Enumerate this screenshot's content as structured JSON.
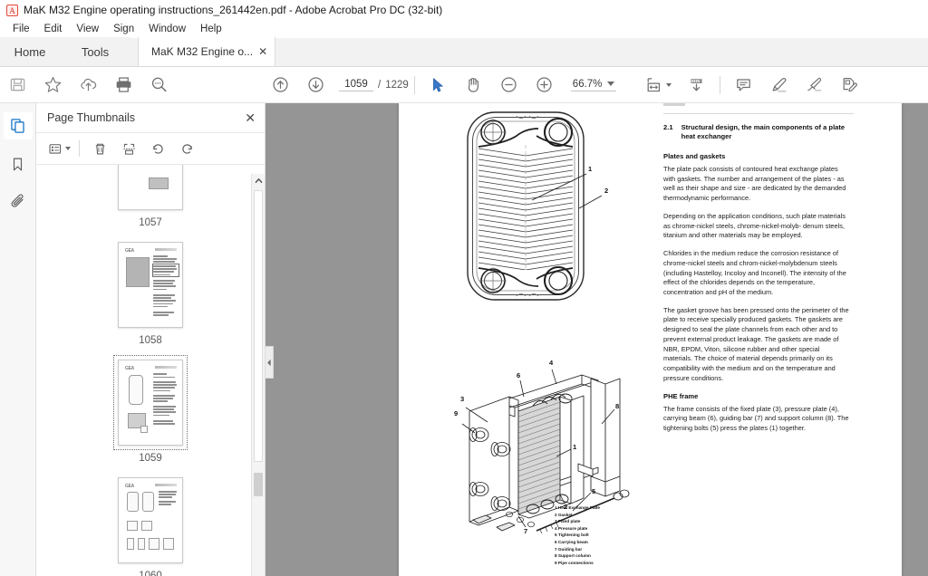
{
  "window": {
    "title": "MaK M32 Engine operating instructions_261442en.pdf - Adobe Acrobat Pro DC (32-bit)",
    "app_icon": "acrobat-logo"
  },
  "menubar": {
    "items": [
      "File",
      "Edit",
      "View",
      "Sign",
      "Window",
      "Help"
    ]
  },
  "tabs": {
    "home": "Home",
    "tools": "Tools",
    "document": "MaK M32 Engine o...",
    "close_glyph": "✕"
  },
  "toolbar": {
    "left_icons": [
      {
        "name": "save-icon",
        "label": "Save"
      },
      {
        "name": "star-icon",
        "label": "Add to favorites"
      },
      {
        "name": "cloud-upload-icon",
        "label": "Upload"
      },
      {
        "name": "print-icon",
        "label": "Print"
      },
      {
        "name": "search-icon",
        "label": "Find"
      }
    ],
    "nav_icons": [
      {
        "name": "previous-page-icon",
        "label": "Previous page"
      },
      {
        "name": "next-page-icon",
        "label": "Next page"
      }
    ],
    "page_current": "1059",
    "page_separator": "/",
    "page_total": "1229",
    "cursor_tools": [
      {
        "name": "select-tool-icon",
        "label": "Select"
      },
      {
        "name": "hand-tool-icon",
        "label": "Hand tool"
      }
    ],
    "zoom_out_icon": "zoom-out-icon",
    "zoom_in_icon": "zoom-in-icon",
    "zoom_level": "66.7%",
    "right_icons": [
      {
        "name": "fit-page-icon",
        "label": "Fit page"
      },
      {
        "name": "scroll-mode-icon",
        "label": "Scroll mode"
      },
      {
        "name": "comment-icon",
        "label": "Add comment"
      },
      {
        "name": "highlight-icon",
        "label": "Highlight text"
      },
      {
        "name": "signature-icon",
        "label": "Sign"
      },
      {
        "name": "edit-pdf-icon",
        "label": "Edit PDF"
      }
    ]
  },
  "rail": {
    "items": [
      {
        "name": "page-thumbnails-icon",
        "label": "Page Thumbnails",
        "active": true
      },
      {
        "name": "bookmarks-icon",
        "label": "Bookmarks",
        "active": false
      },
      {
        "name": "attachments-icon",
        "label": "Attachments",
        "active": false
      }
    ]
  },
  "thumbnail_panel": {
    "title": "Page Thumbnails",
    "close_glyph": "✕",
    "tools": [
      {
        "name": "thumbnail-options-icon",
        "label": "Options"
      },
      {
        "name": "delete-pages-icon",
        "label": "Delete Pages"
      },
      {
        "name": "extract-pages-icon",
        "label": "Extract Pages"
      },
      {
        "name": "rotate-counterclockwise-icon",
        "label": "Rotate Counterclockwise"
      },
      {
        "name": "rotate-clockwise-icon",
        "label": "Rotate Clockwise"
      }
    ],
    "thumbnails": [
      {
        "page": "1057",
        "selected": false,
        "kind": "figure-top"
      },
      {
        "page": "1058",
        "selected": false,
        "kind": "photo-text"
      },
      {
        "page": "1059",
        "selected": true,
        "kind": "diagram-text"
      },
      {
        "page": "1060",
        "selected": false,
        "kind": "multi-figure"
      }
    ]
  },
  "document": {
    "section_number": "2.1",
    "section_title": "Structural design, the main components of a plate heat exchanger",
    "subhead_1": "Plates and gaskets",
    "paragraphs": [
      "The plate pack consists of contoured heat exchange plates with gaskets. The number and arrangement of the plates -  as well as their shape and size - are dedicated by the demanded thermodynamic performance.",
      "Depending on the application conditions, such plate materials as chrome-nickel steels, chrome-nickel-molyb- denum steels, titanium and other materials may be employed.",
      "Chlorides in the medium reduce the corrosion resistance of chrome-nickel steels and chrom-nickel-molybdenum steels (including Hastelloy, Incoloy and Inconell). The intensity of the effect of the chlorides depends on the temperature, concentration and pH of the medium.",
      "The gasket groove has been pressed onto the perimeter of the plate to receive specially produced gaskets. The gaskets are designed to seal the plate channels from each other and to prevent external product leakage. The gaskets are made of NBR, EPDM, Viton, silicone rubber and other special materials. The choice of material depends primarily on its compatibility with the medium and on the temperature and pressure conditions."
    ],
    "subhead_2": "PHE frame",
    "paragraph_frame": "The frame consists of the fixed plate (3), pressure plate (4), carrying beam (6), guiding bar (7) and support column (8). The tightening bolts (5) press the plates (1) together.",
    "figure_plate": {
      "name": "plate-heat-exchanger-plate-diagram",
      "callouts": [
        "1",
        "2"
      ]
    },
    "figure_assembly": {
      "name": "plate-heat-exchanger-frame-assembly-diagram",
      "callouts": [
        "1",
        "2",
        "3",
        "4",
        "5",
        "6",
        "7",
        "8",
        "9"
      ]
    },
    "legend": [
      "1 Heat Exchange Plate",
      "2 Gasket",
      "3 Fixed plate",
      "4 Pressure plate",
      "5 Tightening bolt",
      "6 Carrying beam",
      "7 Guiding bar",
      "8 Support column",
      "9 Pipe connections"
    ]
  },
  "colors": {
    "accent": "#1473c6",
    "workspace": "#959595",
    "chrome": "#f2f2f2"
  }
}
